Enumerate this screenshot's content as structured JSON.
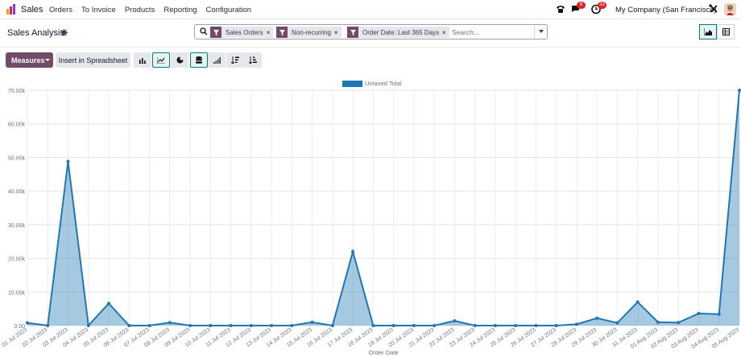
{
  "app": {
    "name": "Sales"
  },
  "menu": [
    {
      "label": "Orders"
    },
    {
      "label": "To Invoice"
    },
    {
      "label": "Products"
    },
    {
      "label": "Reporting"
    },
    {
      "label": "Configuration"
    }
  ],
  "nav": {
    "messages_count": "6",
    "activities_count": "33",
    "company": "My Company (San Francisco)"
  },
  "page": {
    "title": "Sales Analysis"
  },
  "search": {
    "facets": [
      {
        "label": "Sales Orders"
      },
      {
        "label": "Non-recurring"
      },
      {
        "label": "Order Date: Last 365 Days"
      }
    ],
    "placeholder": "Search..."
  },
  "toolbar": {
    "measures_label": "Measures",
    "spreadsheet_label": "Insert in Spreadsheet"
  },
  "colors": {
    "brand": "#714b67",
    "accent": "#017e84",
    "series": "#1f77b4"
  },
  "chart_data": {
    "type": "area",
    "legend": [
      "Untaxed Total"
    ],
    "legend_position": "top-center",
    "xlabel": "Order Date",
    "ylabel": "",
    "ylim": [
      0,
      70000
    ],
    "yticks": [
      "0.00",
      "10.00k",
      "20.00k",
      "30.00k",
      "40.00k",
      "50.00k",
      "60.00k",
      "70.00k"
    ],
    "grid": true,
    "categories": [
      "01 Jul 2023",
      "02 Jul 2023",
      "03 Jul 2023",
      "04 Jul 2023",
      "05 Jul 2023",
      "06 Jul 2023",
      "07 Jul 2023",
      "08 Jul 2023",
      "09 Jul 2023",
      "10 Jul 2023",
      "11 Jul 2023",
      "12 Jul 2023",
      "13 Jul 2023",
      "14 Jul 2023",
      "15 Jul 2023",
      "16 Jul 2023",
      "17 Jul 2023",
      "18 Jul 2023",
      "19 Jul 2023",
      "20 Jul 2023",
      "21 Jul 2023",
      "22 Jul 2023",
      "23 Jul 2023",
      "24 Jul 2023",
      "25 Jul 2023",
      "26 Jul 2023",
      "27 Jul 2023",
      "28 Jul 2023",
      "29 Jul 2023",
      "30 Jul 2023",
      "31 Jul 2023",
      "01 Aug 2023",
      "02 Aug 2023",
      "03 Aug 2023",
      "04 Aug 2023",
      "05 Aug 2023"
    ],
    "series": [
      {
        "name": "Untaxed Total",
        "values": [
          800,
          0,
          48800,
          0,
          6600,
          0,
          0,
          900,
          0,
          0,
          0,
          0,
          0,
          0,
          1000,
          0,
          22000,
          0,
          0,
          0,
          0,
          1400,
          0,
          0,
          0,
          0,
          0,
          400,
          2200,
          800,
          7000,
          1000,
          900,
          3600,
          3400,
          70000
        ]
      }
    ]
  }
}
